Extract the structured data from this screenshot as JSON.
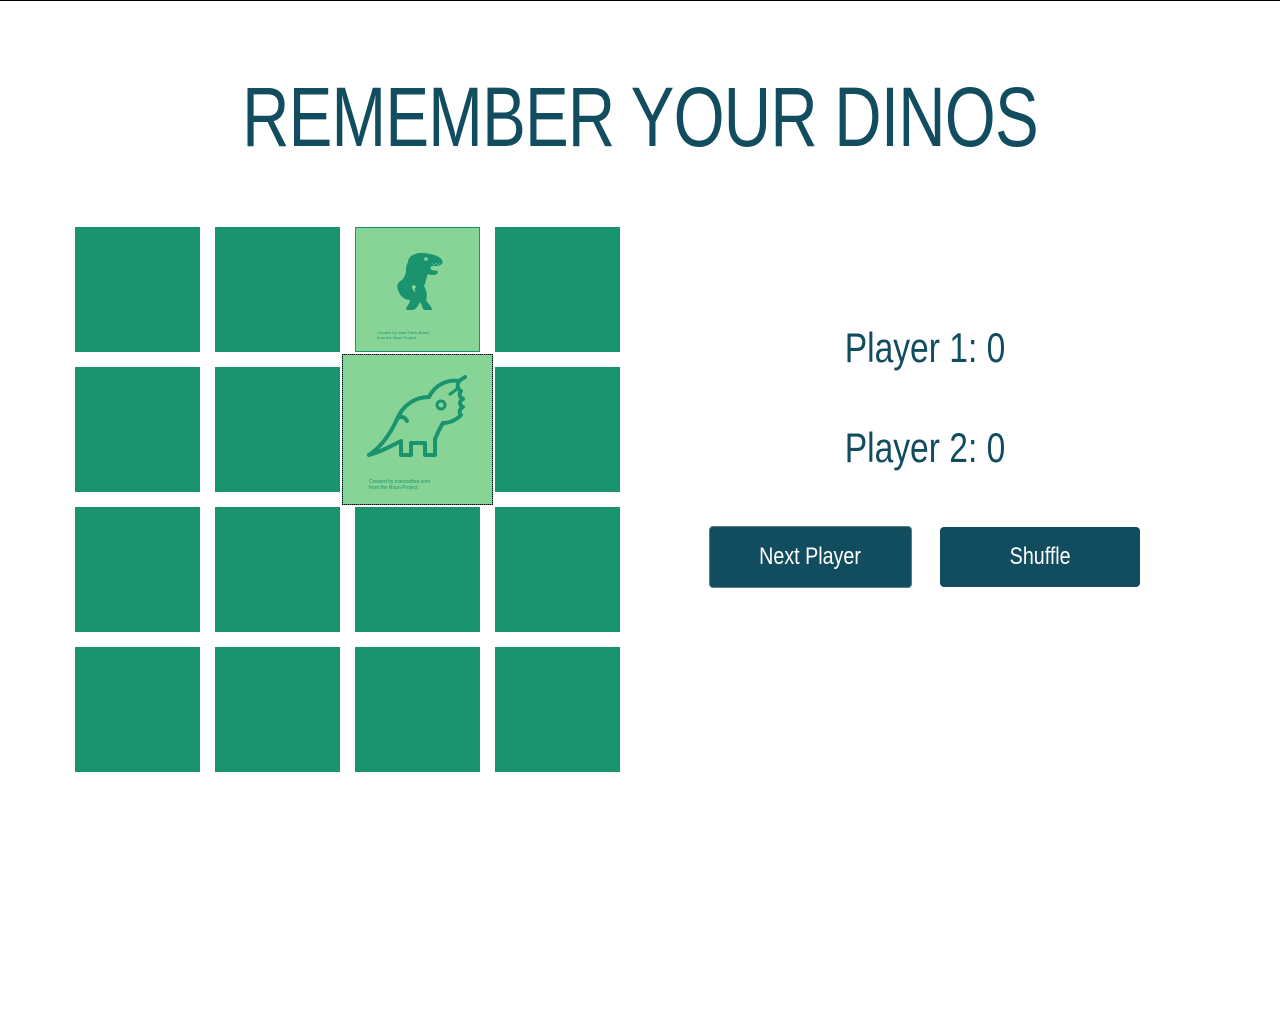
{
  "title": "REMEMBER YOUR DINOS",
  "scores": {
    "player1": "Player 1: 0",
    "player2": "Player 2: 0"
  },
  "buttons": {
    "next_player": "Next Player",
    "shuffle": "Shuffle"
  },
  "colors": {
    "card_back": "#1a946f",
    "card_face": "#88d496",
    "accent": "#124c5f"
  },
  "cards": [
    {
      "state": "face-down"
    },
    {
      "state": "face-down"
    },
    {
      "state": "face-up",
      "icon": "t-rex-icon",
      "credit_line1": "Created by Juan Pablo Bravo",
      "credit_line2": "from the Noun Project"
    },
    {
      "state": "face-down"
    },
    {
      "state": "face-down"
    },
    {
      "state": "face-down"
    },
    {
      "state": "face-up",
      "icon": "triceratops-icon",
      "credit_line1": "Created by iconcrafted.com",
      "credit_line2": "from the Noun Project"
    },
    {
      "state": "face-down"
    },
    {
      "state": "face-down"
    },
    {
      "state": "face-down"
    },
    {
      "state": "face-down"
    },
    {
      "state": "face-down"
    },
    {
      "state": "face-down"
    },
    {
      "state": "face-down"
    },
    {
      "state": "face-down"
    },
    {
      "state": "face-down"
    }
  ]
}
